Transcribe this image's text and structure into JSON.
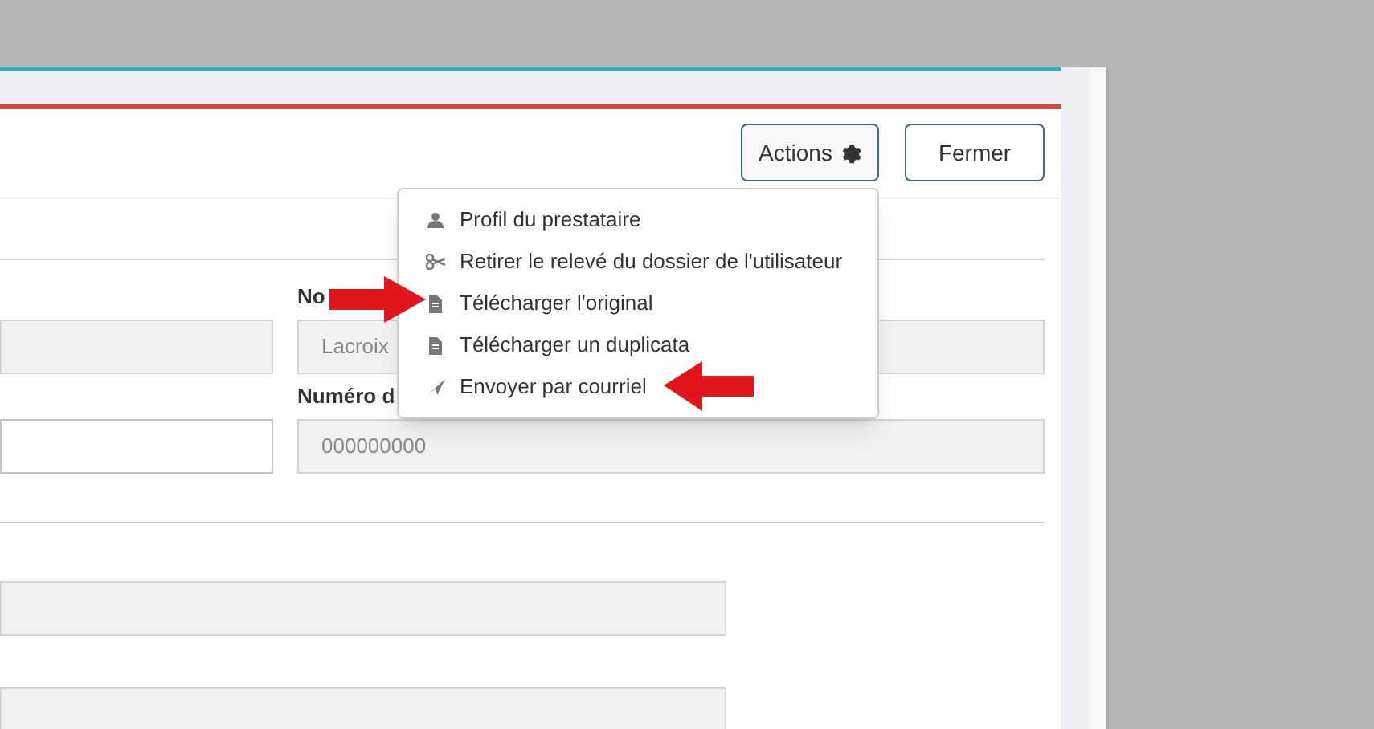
{
  "header_buttons": [
    {
      "label": "Actions",
      "kind": "menu"
    },
    {
      "label": "Fermer",
      "kind": "plain"
    }
  ],
  "actions_menu": {
    "items": [
      {
        "label": "Profil du prestataire",
        "kind": "person"
      },
      {
        "label": "Retirer le relevé du dossier de l'utilisateur",
        "kind": "scissors"
      },
      {
        "label": "Télécharger l'original",
        "kind": "document"
      },
      {
        "label": "Télécharger un duplicata",
        "kind": "document"
      },
      {
        "label": "Envoyer par courriel",
        "kind": "send"
      }
    ]
  },
  "form": {
    "rows": [
      {
        "left": {
          "kind": "readonly"
        },
        "right": {
          "label": "No",
          "value": "Lacroix",
          "kind": "readonly"
        }
      },
      {
        "left": {
          "kind": "editable"
        },
        "right": {
          "label": "Numéro d",
          "value": "000000000",
          "kind": "readonly"
        }
      }
    ],
    "lower_fields": [
      {
        "kind": "readonly"
      },
      {
        "kind": "readonly"
      }
    ]
  }
}
